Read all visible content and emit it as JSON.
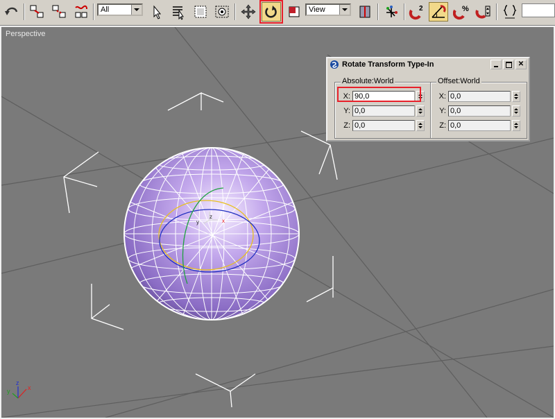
{
  "toolbar": {
    "selection_filter": "All",
    "coordinate_system": "View",
    "buttons": {
      "undo": "undo-icon",
      "select_link": "select-and-link-icon",
      "unlink": "unlink-selection-icon",
      "bind_space_warp": "bind-to-space-warp-icon",
      "select_object": "select-object-icon",
      "select_by_name": "select-by-name-icon",
      "region_select": "rectangular-selection-icon",
      "window_crossing": "window-crossing-icon",
      "move": "select-and-move-icon",
      "rotate": "select-and-rotate-icon",
      "scale": "select-and-scale-icon",
      "pivot": "use-pivot-center-icon",
      "manipulate": "select-and-manipulate-icon",
      "snap": "snap-toggle-icon",
      "snap_mode": "2",
      "angle_snap": "angle-snap-icon",
      "percent_snap": "percent-snap-icon",
      "spinner_snap": "spinner-snap-icon",
      "named_selection": "edit-named-selection-icon"
    }
  },
  "viewport": {
    "label": "Perspective",
    "gizmo": {
      "x_label": "x",
      "y_label": "y",
      "z_label": "z"
    },
    "axis_tripod": {
      "x_label": "x",
      "y_label": "y",
      "z_label": "z"
    }
  },
  "dialog": {
    "title": "Rotate Transform Type-In",
    "absolute": {
      "label": "Absolute:World",
      "x_label": "X:",
      "x": "90,0",
      "y_label": "Y:",
      "y": "0,0",
      "z_label": "Z:",
      "z": "0,0"
    },
    "offset": {
      "label": "Offset:World",
      "x_label": "X:",
      "x": "0,0",
      "y_label": "Y:",
      "y": "0,0",
      "z_label": "Z:",
      "z": "0,0"
    }
  },
  "colors": {
    "viewport_bg": "#7a7a7a",
    "sphere": "#a58ad6",
    "highlight": "#e8202a",
    "active_button": "#f2d98a"
  }
}
